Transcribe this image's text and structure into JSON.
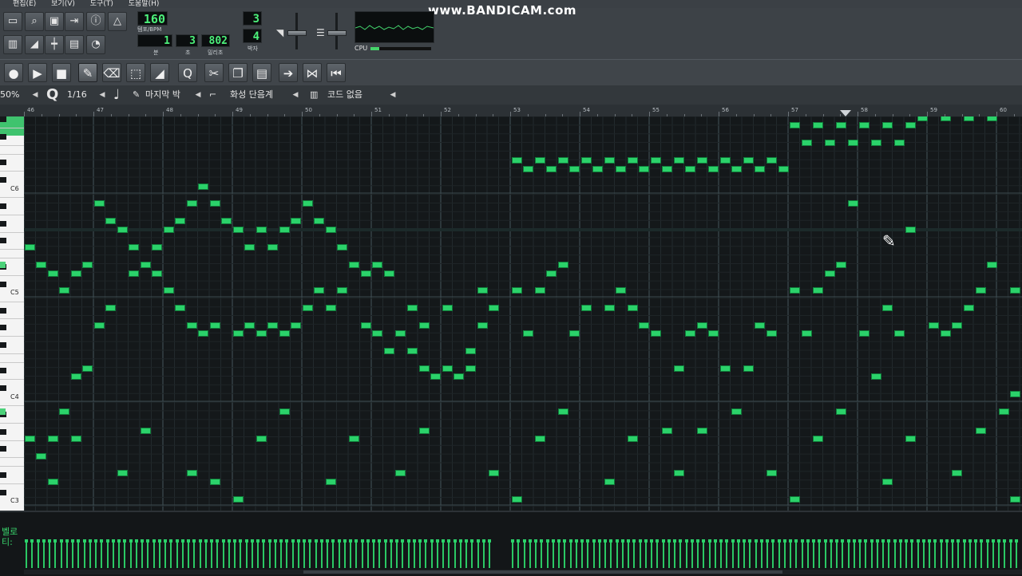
{
  "menu": [
    "편집(E)",
    "보기(V)",
    "도구(T)",
    "도움말(H)"
  ],
  "watermark": "www.BANDICAM.com",
  "lcd": {
    "tempo": "160",
    "tempo_label": "템포/BPM",
    "bar": "1",
    "beat": "3",
    "tick": "802",
    "bar_label": "분",
    "beat_label": "초",
    "tick_label": "밀리초",
    "ts_num": "3",
    "ts_den": "4",
    "ts_label": "박자"
  },
  "cpu_label": "CPU",
  "cpu_load": 0.15,
  "optbar": {
    "zoom": "50%",
    "quantize": "1/16",
    "note_length": "마지막 박",
    "scale": "화성 단음계",
    "chord": "코드 없음"
  },
  "ruler_bars": [
    "46",
    "47",
    "48",
    "49",
    "50",
    "51",
    "52",
    "53",
    "54",
    "55",
    "56",
    "57",
    "58",
    "59",
    "60"
  ],
  "keys": [
    "C6",
    "C5",
    "C4",
    "C3"
  ],
  "velocity_label": "벨로\n티:",
  "icons": {
    "top_row1": [
      "new-file-icon",
      "open-file-icon",
      "save-icon",
      "export-icon",
      "info-icon",
      "metronome-icon"
    ],
    "top_row2": [
      "piano-icon",
      "automation-icon",
      "mixer-icon",
      "project-notes-icon",
      "controller-icon"
    ],
    "tools": [
      "record-icon",
      "play-icon",
      "stop-icon",
      "pencil-icon",
      "eraser-icon",
      "select-icon",
      "detune-icon",
      "quantize-icon",
      "cut-icon",
      "copy-icon",
      "paste-icon",
      "arrow-right-icon",
      "split-icon",
      "rewind-icon"
    ]
  }
}
